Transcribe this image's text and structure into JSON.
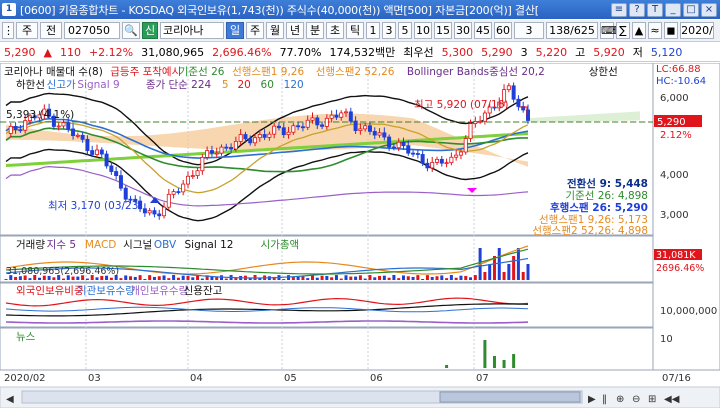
{
  "window": {
    "app_number": "1",
    "title": "[0600] 키움종합차트 - KOSDAQ 외국인보유(1,743(천)) 주식수(40,000(천)) 액면[500] 자본금[200(억)] 결산[",
    "buttons": [
      "≡",
      "?",
      "T",
      "_",
      "□",
      "×"
    ]
  },
  "toolbar": {
    "market": "주",
    "period_type": "전",
    "code": "027050",
    "search_icon": "🔍",
    "type_badge": "신",
    "name": "코리아나",
    "daily": "일",
    "weekly": "주",
    "monthly": "월",
    "yearly": "년",
    "minute": "분",
    "tick": "초",
    "ticks_label": "틱",
    "intervals": [
      "1",
      "3",
      "5",
      "10",
      "15",
      "30",
      "45",
      "60"
    ],
    "count_value": "3",
    "page_value": "138/625",
    "calc_icons": [
      "⌨",
      "∑",
      "▲",
      "≈",
      "◼"
    ],
    "date_value": "2020/"
  },
  "quote": {
    "price": "5,290",
    "change": "110",
    "change_pct": "+2.12%",
    "volume": "31,080,965",
    "vol_ratio": "2,696.46%",
    "turnover": "77.70%",
    "amount": "174,532백만",
    "best_label": "최우선",
    "ask": "5,300",
    "bid": "5,290",
    "bid_qty": "3",
    "low": "5,220",
    "high_label": "고",
    "high": "5,920",
    "close_label": "저",
    "low2": "5,120"
  },
  "colors": {
    "candle_up": "#e0141b",
    "candle_down": "#1f3fd8",
    "cloud": "#f4c89a",
    "ma5": "#e58a1e",
    "ma20": "#2c8f2c",
    "ma60": "#6a2c8a",
    "ma120": "#2c6fd0",
    "bollinger": "#111111",
    "tenkan": "#0a2f8a",
    "kijun": "#2e8b2e",
    "current_price": "#e0141b"
  },
  "legend": {
    "price_panel_row1": [
      {
        "text": "코리아나 매물대 수(8)",
        "color": "#111111"
      },
      {
        "text": "급등주 포착예시",
        "color": "#e0141b"
      },
      {
        "text": "기준선 26",
        "color": "#2e8b2e"
      },
      {
        "text": "선행스팬1 9,26",
        "color": "#e58a1e"
      },
      {
        "text": "선행스팬2 52,26",
        "color": "#e58a1e"
      },
      {
        "text": "Bollinger Bands중심선 20,2",
        "color": "#6a2c8a"
      },
      {
        "text": "상한선",
        "color": "#111111"
      }
    ],
    "price_panel_row2": [
      {
        "text": "하한선",
        "color": "#111111"
      },
      {
        "text": "신고가",
        "color": "#2c6fd0"
      },
      {
        "text": "Signal 9",
        "color": "#9a60c8"
      },
      {
        "text": "종가 단순 224",
        "color": "#6a2c8a"
      },
      {
        "text": "5",
        "color": "#e58a1e"
      },
      {
        "text": "20",
        "color": "#e0141b"
      },
      {
        "text": "60",
        "color": "#2e8b2e"
      },
      {
        "text": "120",
        "color": "#2c6fd0"
      }
    ],
    "lc_hc": {
      "lc": "LC:66.88",
      "hc": "HC:-10.64"
    },
    "volume_panel": [
      {
        "text": "거래량",
        "color": "#111111"
      },
      {
        "text": "지수 5",
        "color": "#6a2c8a"
      },
      {
        "text": "MACD",
        "color": "#e58a1e"
      },
      {
        "text": "시그널",
        "color": "#111111"
      },
      {
        "text": "OBV",
        "color": "#2c6fd0"
      },
      {
        "text": "Signal 12",
        "color": "#111111"
      },
      {
        "text": "시가총액",
        "color": "#2e8b2e"
      }
    ],
    "volume_value": "31,080,965(2,696.46%)",
    "investor_panel": [
      {
        "text": "외국인보유비중",
        "color": "#e0141b"
      },
      {
        "text": "기관보유수량",
        "color": "#2c6fd0"
      },
      {
        "text": "개인보유수량",
        "color": "#9a60c8"
      },
      {
        "text": "신용잔고",
        "color": "#111111"
      }
    ],
    "news_panel": [
      {
        "text": "뉴스",
        "color": "#2e8b2e"
      }
    ]
  },
  "annotations": {
    "high_note": "최고 5,920 (07/16)",
    "low_note": "최저 3,170 (03/23)",
    "level_note": "5,393 (4.1%)",
    "tenkan_value": "전환선 9: 5,448",
    "kijun_value": "기준선 26: 4,898",
    "chikou_value": "후행스팬 26: 5,290",
    "span1_value": "선행스팬1 9,26: 5,173",
    "span2_value": "선행스팬2 52,26: 4,898"
  },
  "right_axis": {
    "price_ticks": [
      "6,000",
      "5,290",
      "2.12%",
      "4,000",
      "3,000"
    ],
    "volume_ticks": [
      "31,081K",
      "2696.46%"
    ],
    "investor_ticks": [
      "10,000,000"
    ],
    "news_ticks": [
      "10"
    ]
  },
  "x_axis": {
    "labels": [
      "2020/02",
      "03",
      "04",
      "05",
      "06",
      "07"
    ],
    "last_date": "07/16"
  },
  "scroll": {
    "left": "◀",
    "right": "▶",
    "icons": [
      "‖",
      "⊕",
      "⊖",
      "⊞",
      "◀◀"
    ]
  },
  "chart_data": {
    "type": "candlestick",
    "y_range": [
      2800,
      6300
    ],
    "close_path_points": [
      [
        "2020/02",
        4900
      ],
      [
        "02",
        5250
      ],
      [
        "02",
        5400
      ],
      [
        "02",
        5150
      ],
      [
        "02",
        4800
      ],
      [
        "03",
        4500
      ],
      [
        "03",
        3900
      ],
      [
        "03",
        3300
      ],
      [
        "03",
        3170
      ],
      [
        "03",
        3600
      ],
      [
        "04",
        4100
      ],
      [
        "04",
        4550
      ],
      [
        "04",
        4700
      ],
      [
        "04",
        4850
      ],
      [
        "04",
        4950
      ],
      [
        "05",
        5050
      ],
      [
        "05",
        5150
      ],
      [
        "05",
        5250
      ],
      [
        "05",
        5393
      ],
      [
        "05",
        5100
      ],
      [
        "06",
        4900
      ],
      [
        "06",
        4700
      ],
      [
        "06",
        4450
      ],
      [
        "06",
        4250
      ],
      [
        "06",
        4400
      ],
      [
        "07",
        5100
      ],
      [
        "07",
        5550
      ],
      [
        "07",
        5920
      ],
      [
        "07",
        5290
      ]
    ]
  }
}
